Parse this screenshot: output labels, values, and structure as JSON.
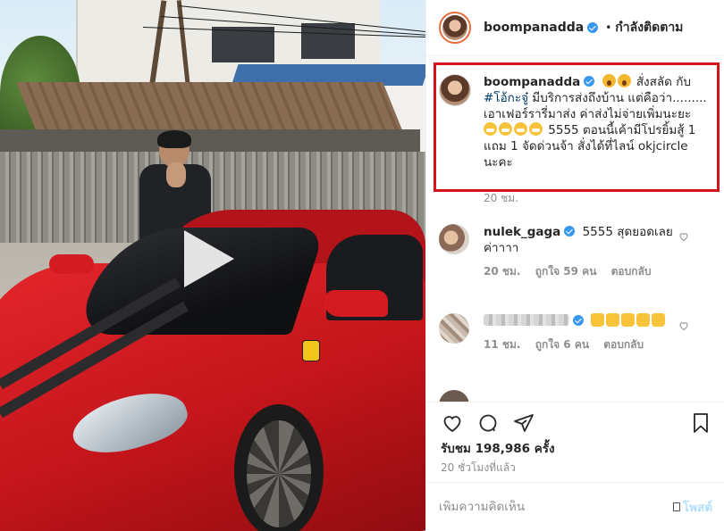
{
  "header": {
    "username": "boompanadda",
    "separator": "•",
    "follow_status": "กำลังติดตาม"
  },
  "caption": {
    "username": "boompanadda",
    "text_1": "สั่งสลัด กับ ",
    "hashtag": "#โอ้กะจู๋",
    "text_2": " มีบริการส่งถึงบ้าน แต่คือว่า......... เอาเฟอร์รารี่มาส่ง ค่าส่งไม่จ่ายเพิ่มนะยะ ",
    "text_3": " 5555 ตอนนี้เค้ามีโปรยิ้มสู้ 1 แถม 1 จัดด่วนจ้า สั่งได้ที่ไลน์ okjcircle นะคะ",
    "time": "20 ชม."
  },
  "comments": [
    {
      "username": "nulek_gaga",
      "text": "5555 สุดยอดเลยค่าาาา",
      "time": "20 ชม.",
      "likes": "ถูกใจ 59 คน",
      "reply": "ตอบกลับ"
    },
    {
      "username": "",
      "text": "",
      "time": "11 ชม.",
      "likes": "ถูกใจ 6 คน",
      "reply": "ตอบกลับ"
    }
  ],
  "stats": {
    "views": "รับชม 198,986 ครั้ง",
    "ago": "20 ชั่วโมงที่แล้ว"
  },
  "add_comment": {
    "placeholder": "เพิ่มความคิดเห็น",
    "post_label": "โพสต์"
  },
  "icons": {
    "like": "heart-icon",
    "comment": "comment-icon",
    "share": "share-icon",
    "save": "bookmark-icon",
    "play": "play-icon",
    "verified": "verified-badge-icon"
  },
  "colors": {
    "highlight_border": "#d4141a",
    "verified_blue": "#3897f0",
    "hashtag": "#00376b",
    "post_button_disabled": "#b2dffc"
  }
}
